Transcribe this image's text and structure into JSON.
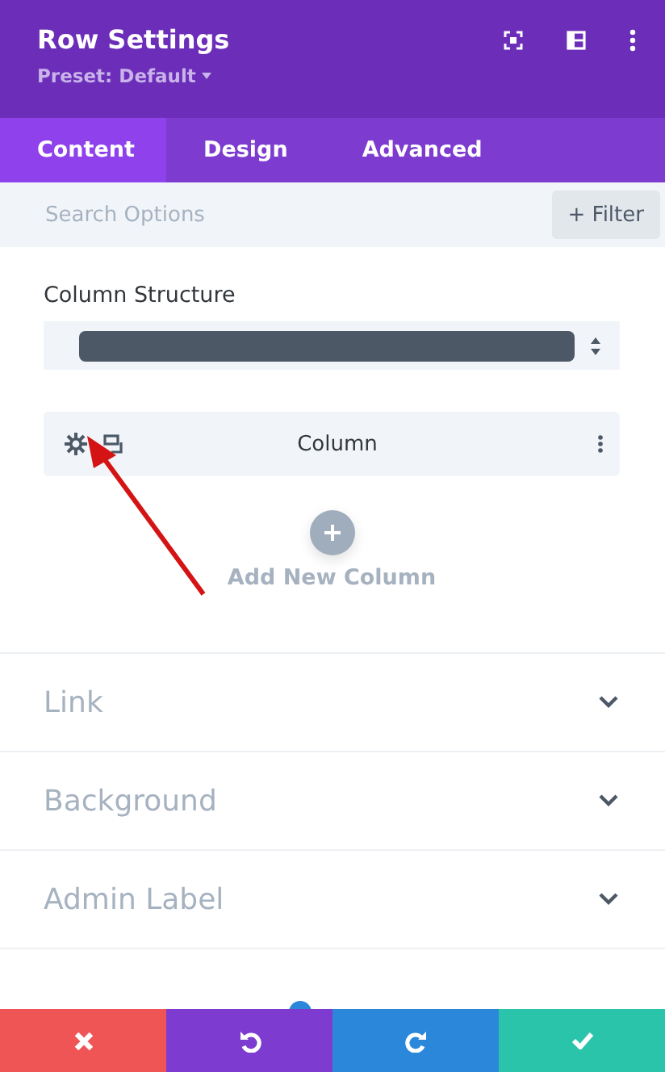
{
  "header": {
    "title": "Row Settings",
    "preset": "Preset: Default"
  },
  "tabs": [
    {
      "label": "Content",
      "selected": true
    },
    {
      "label": "Design",
      "selected": false
    },
    {
      "label": "Advanced",
      "selected": false
    }
  ],
  "search": {
    "placeholder": "Search Options",
    "filter_button": "+ Filter"
  },
  "column_structure": {
    "label": "Column Structure"
  },
  "columns": [
    {
      "label": "Column"
    }
  ],
  "add_column": {
    "label": "Add New Column"
  },
  "sections": [
    {
      "title": "Link"
    },
    {
      "title": "Background"
    },
    {
      "title": "Admin Label"
    }
  ],
  "footer_buttons": [
    {
      "kind": "discard",
      "color": "#ef5555"
    },
    {
      "kind": "undo",
      "color": "#7e3bd0"
    },
    {
      "kind": "redo",
      "color": "#2b87da"
    },
    {
      "kind": "save",
      "color": "#29c4a9"
    }
  ]
}
